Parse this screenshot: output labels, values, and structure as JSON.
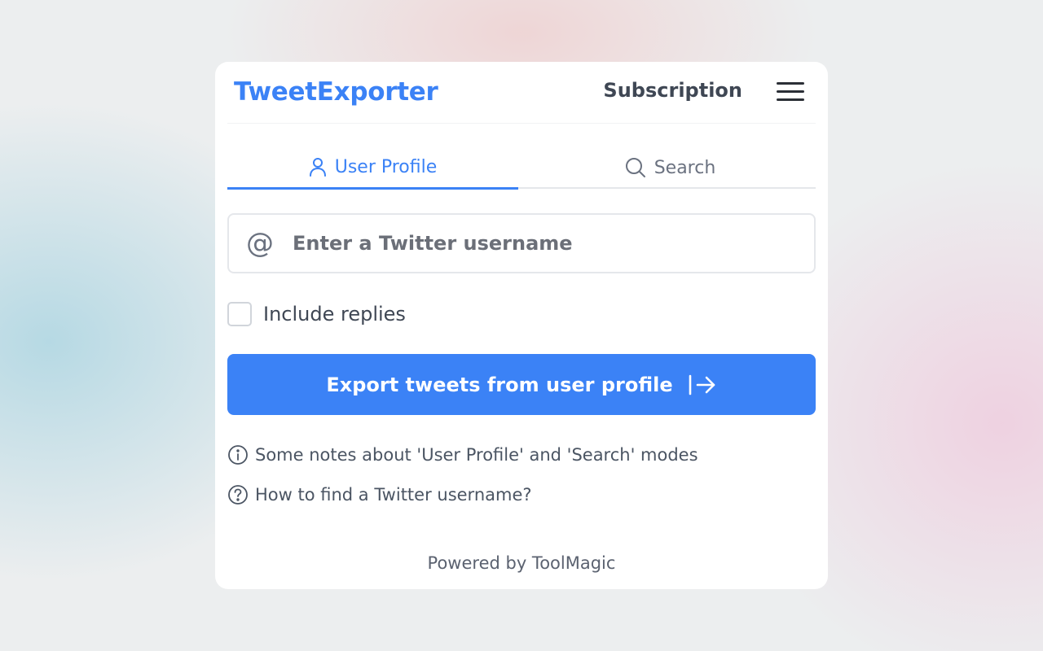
{
  "header": {
    "brand": "TweetExporter",
    "subscription_label": "Subscription",
    "menu_icon": "hamburger-menu-icon"
  },
  "tabs": [
    {
      "label": "User Profile",
      "icon": "user-icon",
      "active": true
    },
    {
      "label": "Search",
      "icon": "search-icon",
      "active": false
    }
  ],
  "username_input": {
    "prefix": "@",
    "placeholder": "Enter a Twitter username",
    "value": ""
  },
  "include_replies": {
    "label": "Include replies",
    "checked": false
  },
  "export_button": {
    "label": "Export tweets from user profile",
    "icon": "arrow-right-to-bar-icon"
  },
  "links": [
    {
      "label": "Some notes about 'User Profile' and 'Search' modes",
      "icon": "info-circle-icon"
    },
    {
      "label": "How to find a Twitter username?",
      "icon": "question-circle-icon"
    }
  ],
  "footer": {
    "text": "Powered by ToolMagic"
  },
  "colors": {
    "accent": "#3b82f6",
    "text_dark": "#3f4754",
    "text_muted": "#6b7280"
  }
}
